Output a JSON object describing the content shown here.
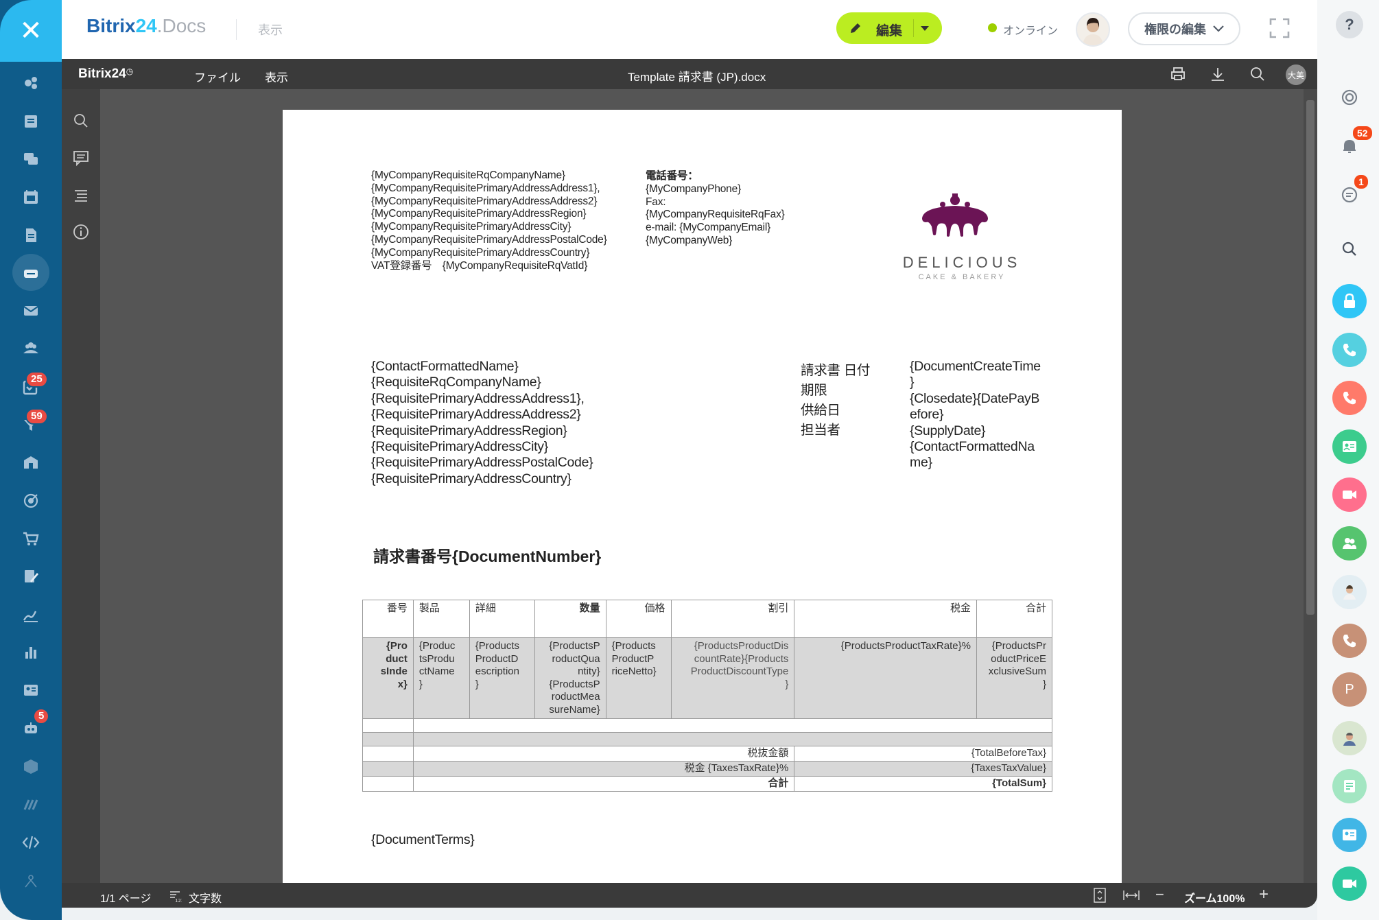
{
  "app": {
    "brand_main": "Bitrix",
    "brand_num": "24",
    "brand_suffix": ".Docs",
    "view_label": "表示",
    "edit_label": "編集",
    "online_label": "オンライン",
    "permissions_label": "権限の編集"
  },
  "left_sidebar": {
    "close_glyph": "✕",
    "badges": {
      "tasks": "25",
      "filter": "59",
      "robot": "5"
    },
    "items": [
      "feed-icon",
      "news-icon",
      "chat-icon",
      "calendar-icon",
      "docs-icon",
      "drive-icon",
      "mail-icon",
      "workgroups-icon",
      "tasks-icon",
      "crm-icon",
      "company-icon",
      "goals-icon",
      "shop-icon",
      "sign-icon",
      "esign-icon",
      "analytics-icon",
      "contacts-icon",
      "robot-icon",
      "box-icon",
      "marketplace-icon",
      "devops-icon",
      "user-icon"
    ]
  },
  "editor": {
    "brand": "Bitrix24",
    "menu": [
      "ファイル",
      "表示"
    ],
    "doc_title": "Template 請求書 (JP).docx",
    "user_initials": "大美"
  },
  "status": {
    "pages": "1/1 ページ",
    "word_count": "文字数",
    "zoom": "ズーム100%"
  },
  "document": {
    "company_lines": [
      "{MyCompanyRequisiteRqCompanyName}",
      "{MyCompanyRequisitePrimaryAddressAddress1},",
      "{MyCompanyRequisitePrimaryAddressAddress2}",
      "{MyCompanyRequisitePrimaryAddressRegion}",
      "{MyCompanyRequisitePrimaryAddressCity}",
      "{MyCompanyRequisitePrimaryAddressPostalCode}",
      "{MyCompanyRequisitePrimaryAddressCountry}",
      "VAT登録番号　{MyCompanyRequisiteRqVatId}"
    ],
    "contact_lines": [
      "電話番号：",
      "{MyCompanyPhone}",
      "Fax:",
      "{MyCompanyRequisiteRqFax}",
      "e-mail: {MyCompanyEmail}",
      "{MyCompanyWeb}"
    ],
    "logo": {
      "name": "DELICIOUS",
      "tagline": "CAKE & BAKERY",
      "color": "#6b1455"
    },
    "client_lines": [
      "{ContactFormattedName}",
      "{RequisiteRqCompanyName}",
      "{RequisitePrimaryAddressAddress1},",
      "{RequisitePrimaryAddressAddress2}",
      "{RequisitePrimaryAddressRegion}",
      "{RequisitePrimaryAddressCity}",
      "{RequisitePrimaryAddressPostalCode}",
      "{RequisitePrimaryAddressCountry}"
    ],
    "meta_labels": [
      "請求書 日付",
      "期限",
      "供給日",
      "担当者"
    ],
    "meta_values": [
      "{DocumentCreateTime",
      "}",
      "{Closedate}{DatePayB",
      "efore}",
      "{SupplyDate}",
      "{ContactFormattedNa",
      "me}"
    ],
    "invoice_title": "請求書番号{DocumentNumber}",
    "table": {
      "headers": [
        "番号",
        "製品",
        "詳細",
        "数量",
        "価格",
        "割引",
        "税金",
        "合計"
      ],
      "row": [
        "{Pro\nduct\nsInde\nx}",
        "{Produc\ntsProdu\nctName\n}",
        "{Products\nProductD\nescription\n}",
        "{ProductsP\nroductQua\nntity}\n{ProductsP\nroductMea\nsureName}",
        "{Products\nProductP\nriceNetto}",
        "{ProductsProductDis\ncountRate}{Products\nProductDiscountType\n}",
        "{ProductsProductTaxRate}%",
        "{ProductsPr\noductPriceE\nxclusiveSum\n}"
      ],
      "summary": [
        {
          "label": "税抜金額",
          "value": "{TotalBeforeTax}"
        },
        {
          "label": "税金 {TaxesTaxRate}%",
          "value": "{TaxesTaxValue}"
        },
        {
          "label": "合計",
          "value": "{TotalSum}"
        }
      ]
    },
    "terms": "{DocumentTerms}"
  },
  "right_sidebar": {
    "badges": {
      "notifications": "52",
      "messages": "1"
    },
    "avatar_letter": "P"
  }
}
